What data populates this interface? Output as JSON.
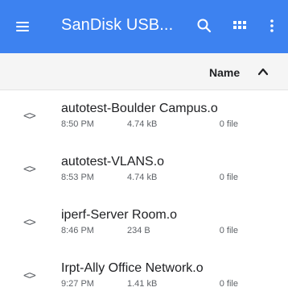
{
  "colors": {
    "appbar": "#3d82f0",
    "sortbar": "#f5f5f5"
  },
  "appbar": {
    "title": "SanDisk USB...",
    "icons": [
      "menu-icon",
      "search-icon",
      "grid-view-icon",
      "more-vert-icon"
    ]
  },
  "sortbar": {
    "label": "Name",
    "direction_icon": "chevron-up-icon"
  },
  "files": [
    {
      "name": "autotest-Boulder Campus.o",
      "time": "8:50 PM",
      "size": "4.74 kB",
      "count": "0 file"
    },
    {
      "name": "autotest-VLANS.o",
      "time": "8:53 PM",
      "size": "4.74 kB",
      "count": "0 file"
    },
    {
      "name": "iperf-Server Room.o",
      "time": "8:46 PM",
      "size": "234 B",
      "count": "0 file"
    },
    {
      "name": "Irpt-Ally Office Network.o",
      "time": "9:27 PM",
      "size": "1.41 kB",
      "count": "0 file"
    }
  ]
}
